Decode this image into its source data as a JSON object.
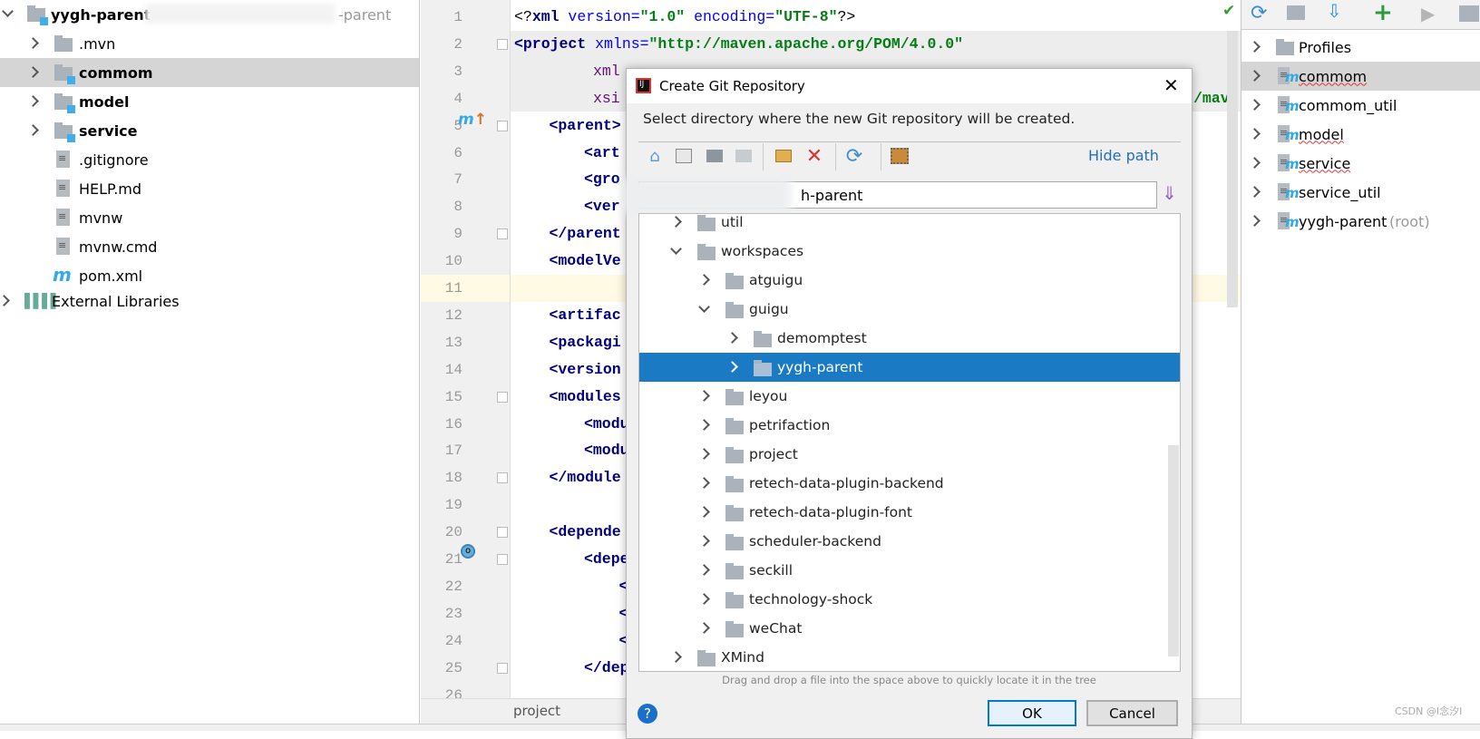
{
  "project_tree": {
    "root": {
      "label": "yygh-parent",
      "suffix": "-parent"
    },
    "items": [
      {
        "label": ".mvn",
        "type": "folder",
        "bold": false
      },
      {
        "label": "commom",
        "type": "module",
        "bold": true,
        "selected": true
      },
      {
        "label": "model",
        "type": "module",
        "bold": true
      },
      {
        "label": "service",
        "type": "module",
        "bold": true
      },
      {
        "label": ".gitignore",
        "type": "file"
      },
      {
        "label": "HELP.md",
        "type": "md"
      },
      {
        "label": "mvnw",
        "type": "file"
      },
      {
        "label": "mvnw.cmd",
        "type": "file"
      },
      {
        "label": "pom.xml",
        "type": "maven"
      }
    ],
    "external": "External Libraries"
  },
  "editor": {
    "line1": {
      "open": "<?",
      "tag": "xml",
      "a1": " version=",
      "v1": "\"1.0\"",
      "a2": " encoding=",
      "v2": "\"UTF-8\"",
      "close": "?>"
    },
    "line2": {
      "tag": "<project",
      "a1": " xmlns=",
      "v1": "\"http://maven.apache.org/POM/4.0.0\""
    },
    "line3": {
      "a1": "xml"
    },
    "line4": {
      "a1": "xsi",
      "right": "/mave"
    },
    "lines": [
      "",
      "",
      "",
      "",
      "<parent>",
      "<art",
      "<gro",
      "<ver",
      "</parent",
      "<modelVe",
      "",
      "<artifac",
      "<packagi",
      "<version",
      "<modules",
      "<modu",
      "<modu",
      "</module",
      "",
      "<depende",
      "<depe",
      "<",
      "<",
      "<",
      "</dep",
      ""
    ],
    "indent": [
      0,
      0,
      0,
      0,
      1,
      2,
      2,
      2,
      1,
      1,
      0,
      1,
      1,
      1,
      1,
      2,
      2,
      1,
      0,
      1,
      2,
      3,
      3,
      3,
      2,
      0
    ],
    "status_tab": "project"
  },
  "maven": {
    "items": [
      {
        "label": "Profiles",
        "type": "profiles"
      },
      {
        "label": "commom",
        "squiggle": true,
        "selected": true
      },
      {
        "label": "commom_util"
      },
      {
        "label": "model",
        "squiggle": true
      },
      {
        "label": "service",
        "squiggle": true
      },
      {
        "label": "service_util"
      },
      {
        "label": "yygh-parent",
        "note": "(root)"
      }
    ]
  },
  "dialog": {
    "title": "Create Git Repository",
    "subtitle": "Select directory where the new Git repository will be created.",
    "hide_path": "Hide path",
    "path_value": "h-parent",
    "tree": [
      {
        "label": "util",
        "level": 0,
        "expanded": false
      },
      {
        "label": "workspaces",
        "level": 0,
        "expanded": true
      },
      {
        "label": "atguigu",
        "level": 1,
        "expanded": false
      },
      {
        "label": "guigu",
        "level": 1,
        "expanded": true
      },
      {
        "label": "demomptest",
        "level": 2,
        "expanded": false
      },
      {
        "label": "yygh-parent",
        "level": 2,
        "expanded": false,
        "selected": true
      },
      {
        "label": "leyou",
        "level": 1,
        "expanded": false
      },
      {
        "label": "petrifaction",
        "level": 1,
        "expanded": false
      },
      {
        "label": "project",
        "level": 1,
        "expanded": false
      },
      {
        "label": "retech-data-plugin-backend",
        "level": 1,
        "expanded": false
      },
      {
        "label": "retech-data-plugin-font",
        "level": 1,
        "expanded": false
      },
      {
        "label": "scheduler-backend",
        "level": 1,
        "expanded": false
      },
      {
        "label": "seckill",
        "level": 1,
        "expanded": false
      },
      {
        "label": "technology-shock",
        "level": 1,
        "expanded": false
      },
      {
        "label": "weChat",
        "level": 1,
        "expanded": false
      },
      {
        "label": "XMind",
        "level": 0,
        "expanded": false
      }
    ],
    "hint": "Drag and drop a file into the space above to quickly locate it in the tree",
    "ok": "OK",
    "cancel": "Cancel",
    "help": "?"
  },
  "watermark": "CSDN @I念汐I",
  "colors": {
    "selection": "#1b7ac4",
    "module_badge": "#40aee8",
    "tag": "#000080",
    "value": "#067d17"
  }
}
